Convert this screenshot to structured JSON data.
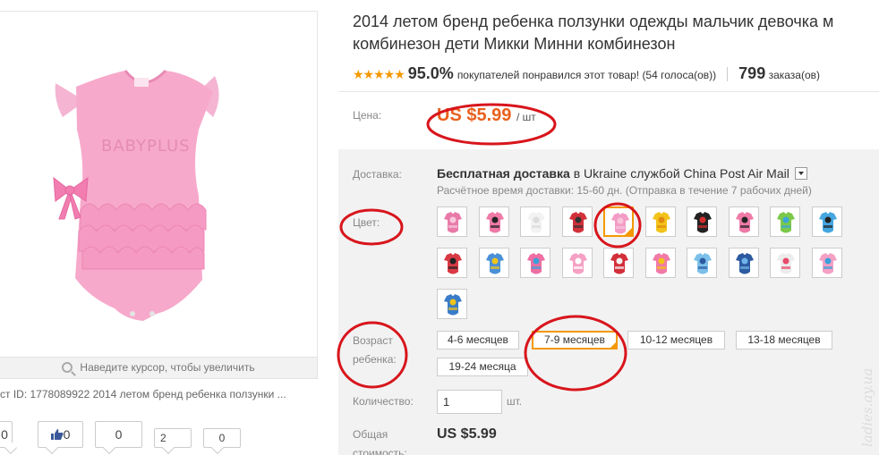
{
  "product": {
    "title_line1": "2014 летом бренд ребенка ползунки одежды мальчик девочка м",
    "title_line2": "комбинезон дети Микки Минни комбинезон",
    "image_text": "BABYPLUS",
    "zoom_hint": "Наведите курсор, чтобы увеличить",
    "product_id_line": "ст ID: 1778089922 2014 летом бренд ребенка ползунки ..."
  },
  "rating": {
    "stars": "★★★★★",
    "percent": "95.0%",
    "text": "покупателей понравился этот товар! (54 голоса(ов))",
    "orders_count": "799",
    "orders_label": "заказа(ов)"
  },
  "price": {
    "label": "Цена:",
    "value": "US $5.99",
    "unit": "/ шт"
  },
  "shipping": {
    "label": "Доставка:",
    "title": "Бесплатная доставка",
    "in": "в",
    "country": "Ukraine",
    "by": "службой China Post Air Mail",
    "estimate": "Расчётное время доставки: 15-60 дн. (Отправка в течение 7 рабочих дней)"
  },
  "color": {
    "label": "Цвет:",
    "selected_index": 4,
    "swatches": [
      {
        "icon": "pink-romper-set",
        "main": "#e87aa8",
        "accent": "#f6c9dc"
      },
      {
        "icon": "minnie-pink-romper",
        "main": "#f07aa8",
        "accent": "#222222"
      },
      {
        "icon": "white-romper",
        "main": "#f2f2f2",
        "accent": "#dcdcdc"
      },
      {
        "icon": "red-black-romper",
        "main": "#d2303a",
        "accent": "#333333"
      },
      {
        "icon": "pink-ruffle-romper",
        "main": "#f39cc6",
        "accent": "#f7c6dd"
      },
      {
        "icon": "yellow-pooh-romper",
        "main": "#f2c318",
        "accent": "#e08a10"
      },
      {
        "icon": "mickey-black-romper",
        "main": "#222222",
        "accent": "#d62e2e"
      },
      {
        "icon": "minnie-dots-romper",
        "main": "#f07aa8",
        "accent": "#222222"
      },
      {
        "icon": "green-frog-romper",
        "main": "#7cc84a",
        "accent": "#3aa7d8"
      },
      {
        "icon": "blue-mickey-romper",
        "main": "#46a6df",
        "accent": "#222222"
      },
      {
        "icon": "minnie-red-romper",
        "main": "#d83a44",
        "accent": "#222222"
      },
      {
        "icon": "blue-yellow-romper",
        "main": "#4a90d8",
        "accent": "#f2c318"
      },
      {
        "icon": "pink-hooded-romper",
        "main": "#ee6fa3",
        "accent": "#3aa0d8"
      },
      {
        "icon": "hello-kitty-romper",
        "main": "#f5a0c4",
        "accent": "#ffffff"
      },
      {
        "icon": "red-mickey-romper",
        "main": "#d32f3a",
        "accent": "#f2f2f2"
      },
      {
        "icon": "pink-minnie-romper",
        "main": "#f07aa8",
        "accent": "#f2c318"
      },
      {
        "icon": "light-blue-romper",
        "main": "#7cc0ea",
        "accent": "#2c5aa0"
      },
      {
        "icon": "navy-mickey-romper",
        "main": "#2c5aa0",
        "accent": "#6fb3e8"
      },
      {
        "icon": "kitty-white-romper",
        "main": "#ececec",
        "accent": "#e84a6a"
      },
      {
        "icon": "pink-minnie-set",
        "main": "#f5a0c4",
        "accent": "#3aa0d8"
      },
      {
        "icon": "mickey-blue-set",
        "main": "#3a7cc8",
        "accent": "#f2c318"
      }
    ]
  },
  "age": {
    "label_line1": "Возраст",
    "label_line2": "ребенка:",
    "options": [
      "4-6 месяцев",
      "7-9 месяцев",
      "10-12 месяцев",
      "13-18 месяцев",
      "19-24 месяца"
    ],
    "selected_index": 1
  },
  "quantity": {
    "label": "Количество:",
    "value": "1",
    "unit": "шт."
  },
  "total": {
    "label_line1": "Общая",
    "label_line2": "стоимость:",
    "value": "US $5.99"
  },
  "social": {
    "count_a": "0",
    "like_count": "0",
    "count_b": "0",
    "count_c": "2",
    "count_d": "0"
  },
  "watermark": "ladies.ay.ua",
  "colors": {
    "accent_orange": "#f39800",
    "price_orange": "#e8601c",
    "annotation_red": "#d8151c",
    "panel_gray": "#f2f2f2"
  }
}
